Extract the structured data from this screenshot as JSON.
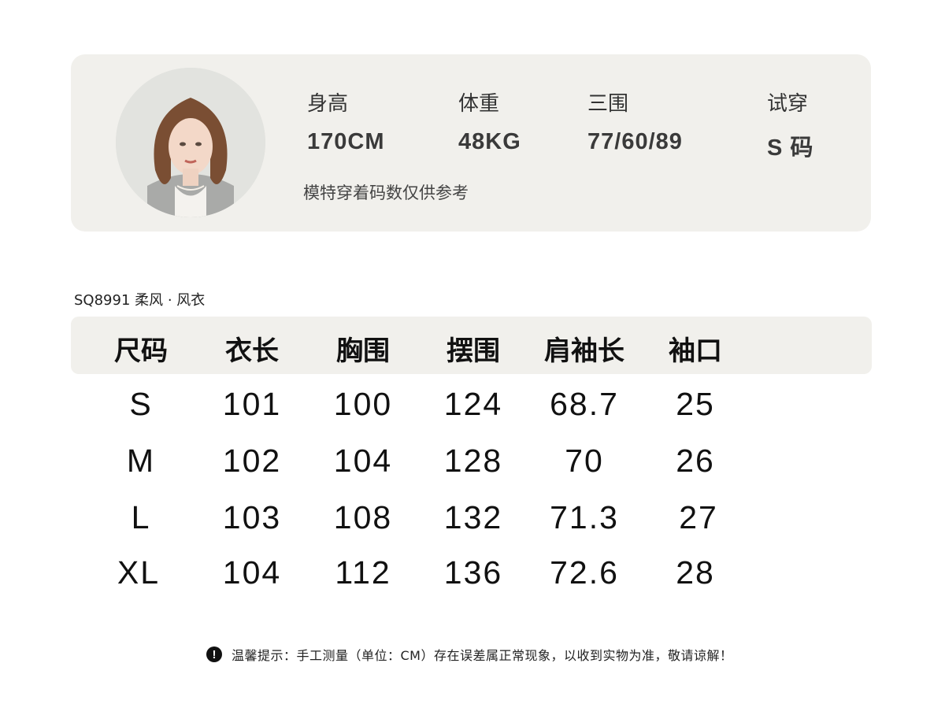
{
  "model": {
    "stats": [
      {
        "label": "身高",
        "value": "170CM"
      },
      {
        "label": "体重",
        "value": "48KG"
      },
      {
        "label": "三围",
        "value": "77/60/89"
      },
      {
        "label": "试穿",
        "value": "S 码"
      }
    ],
    "note": "模特穿着码数仅供参考"
  },
  "product": {
    "title": "SQ8991  柔风 · 风衣"
  },
  "size_table": {
    "headers": [
      "尺码",
      "衣长",
      "胸围",
      "摆围",
      "肩袖长",
      "袖口"
    ],
    "rows": [
      [
        "S",
        "101",
        "100",
        "124",
        "68.7",
        "25"
      ],
      [
        "M",
        "102",
        "104",
        "128",
        "70",
        "26"
      ],
      [
        "L",
        "103",
        "108",
        "132",
        "71.3",
        "27"
      ],
      [
        "XL",
        "104",
        "112",
        "136",
        "72.6",
        "28"
      ]
    ]
  },
  "notice": {
    "icon": "exclamation-icon",
    "text": "温馨提示：手工测量（单位：CM）存在误差属正常现象，以收到实物为准，敬请谅解！"
  }
}
